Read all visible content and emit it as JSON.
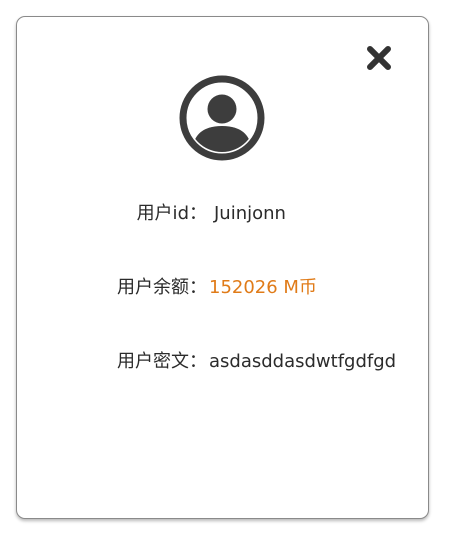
{
  "dialog": {
    "close_icon": "close-icon",
    "avatar_icon": "user-avatar-icon",
    "user_id": {
      "label": "用户id：",
      "value": "Juinjonn"
    },
    "balance": {
      "label": "用户余额：",
      "value": "152026  M币",
      "color": "#e07b18"
    },
    "cipher": {
      "label": "用户密文：",
      "value": "asdasddasdwtfgdfgd"
    }
  }
}
